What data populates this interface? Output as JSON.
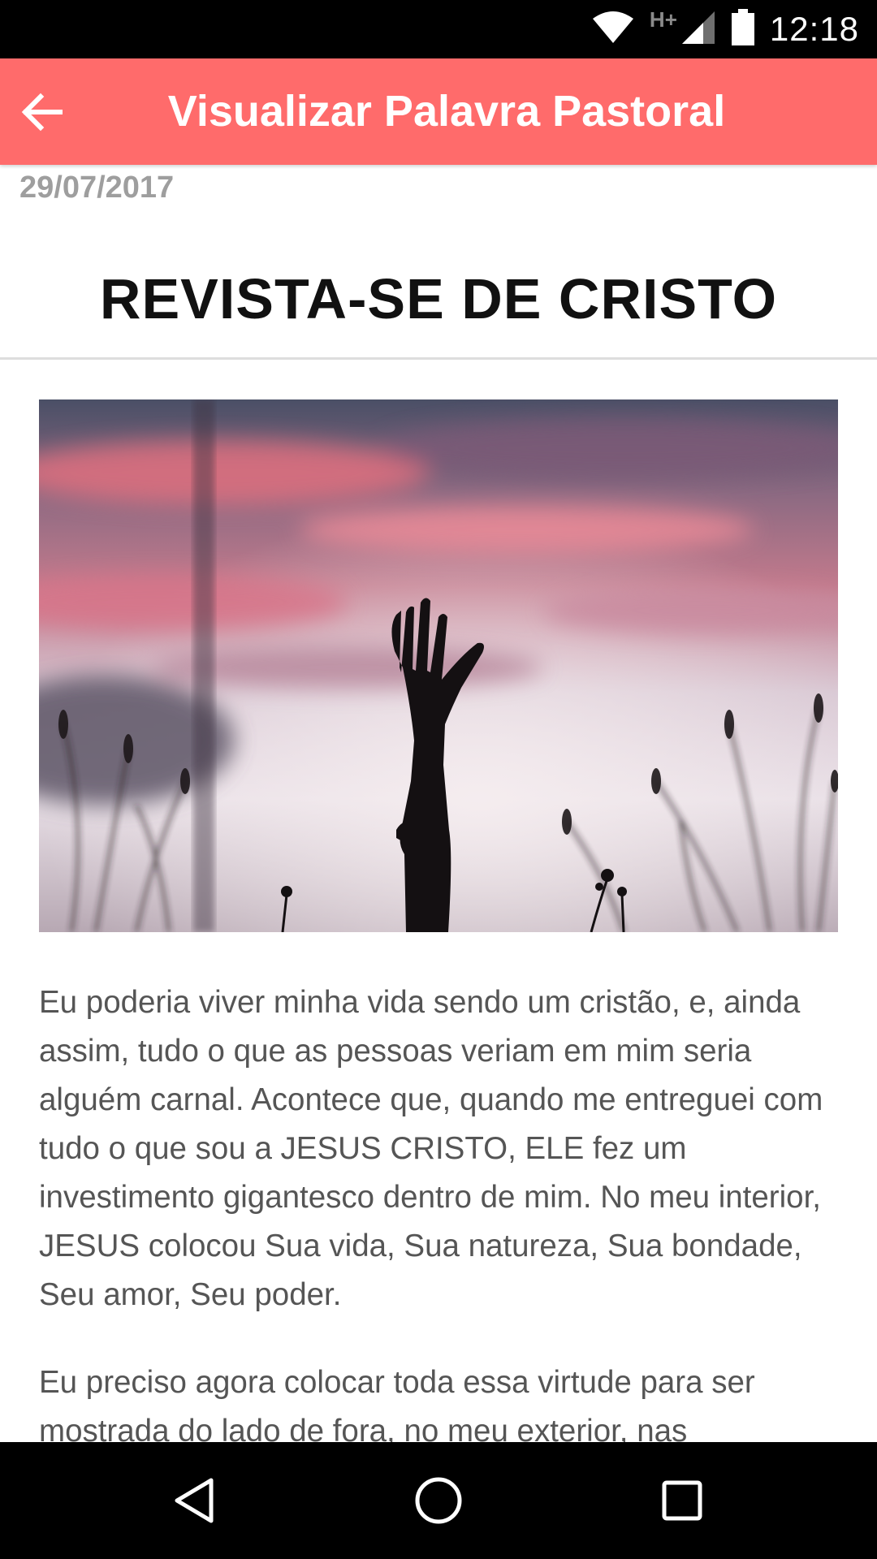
{
  "status_bar": {
    "time": "12:18",
    "network_type": "H+",
    "icons": [
      "wifi-icon",
      "cell-signal-icon",
      "battery-icon"
    ]
  },
  "app_bar": {
    "title": "Visualizar Palavra Pastoral",
    "back_icon": "arrow-back-icon"
  },
  "post": {
    "date": "29/07/2017",
    "title": "REVISTA-SE DE CRISTO",
    "image": "raised-hand-silhouette-at-sunset",
    "paragraphs": [
      "Eu poderia viver minha vida sendo um cristão, e, ainda assim, tudo o que as pessoas veriam em mim seria alguém carnal. Acontece que, quando me entreguei com tudo o que sou a JESUS CRISTO, ELE fez um investimento gigantesco dentro de mim. No meu interior, JESUS colocou Sua vida, Sua natureza, Sua bondade, Seu amor, Seu poder.",
      "Eu preciso agora colocar toda essa virtude para ser mostrada do lado de fora, no meu exterior, nas"
    ]
  },
  "nav_bar": {
    "buttons": [
      "back-triangle-icon",
      "home-circle-icon",
      "recents-square-icon"
    ]
  },
  "colors": {
    "app_bar": "#ff6b6b",
    "date_text": "#9e9e9e",
    "body_text": "#555555"
  }
}
